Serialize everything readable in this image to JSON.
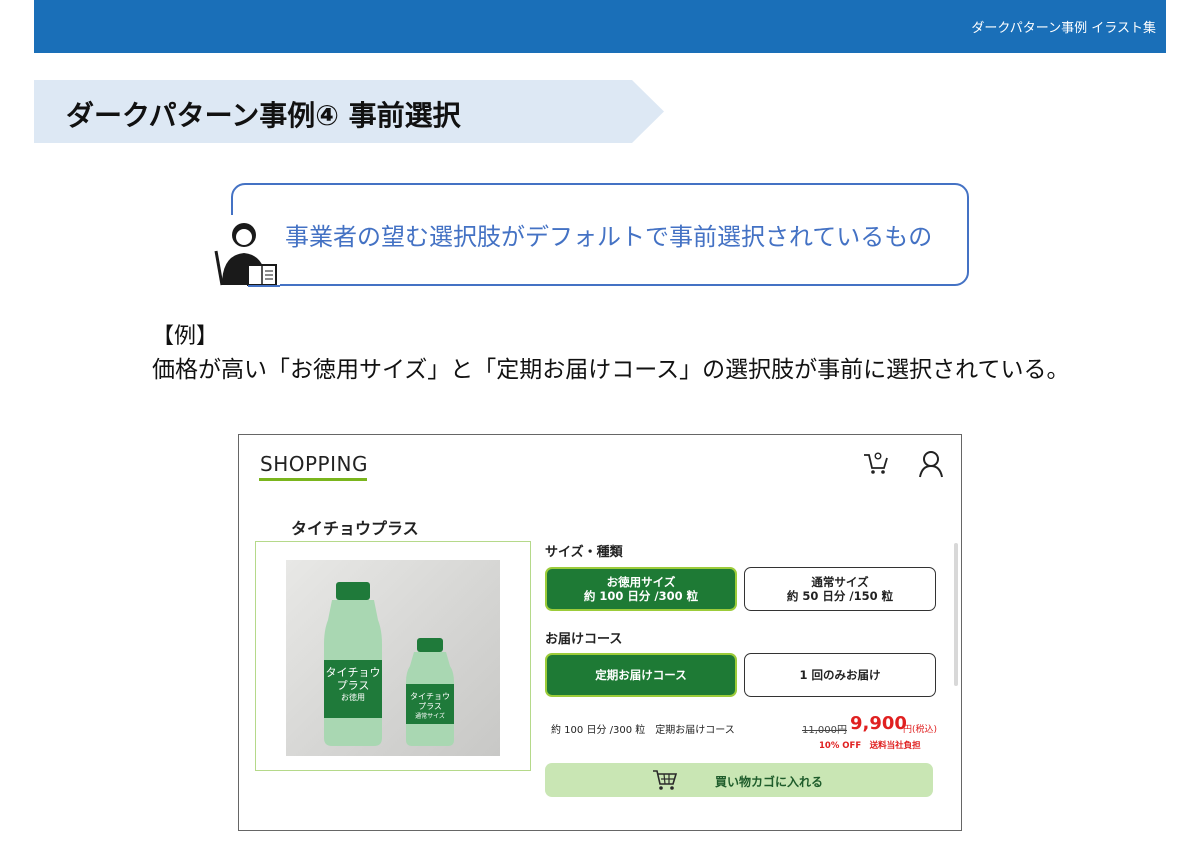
{
  "header": {
    "title": "ダークパターン事例 イラスト集",
    "color": "#1a6fb8"
  },
  "section": {
    "title": "ダークパターン事例④ 事前選択"
  },
  "definition": {
    "text": "事業者の望む選択肢がデフォルトで事前選択されているもの",
    "icon": "teacher-icon"
  },
  "example": {
    "label": "【例】",
    "text": "価格が高い「お徳用サイズ」と「定期お届けコース」の選択肢が事前に選択されている。"
  },
  "shop": {
    "logo": "SHOPPING",
    "accent": "#7ab51d",
    "product_name": "タイチョウプラス",
    "bottle_large": [
      "タイチョウ",
      "プラス",
      "お徳用"
    ],
    "bottle_small": [
      "タイチョウ",
      "プラス",
      "通常サイズ"
    ],
    "size_label": "サイズ・種類",
    "size_options": [
      {
        "line1": "お徳用サイズ",
        "line2": "約 100 日分 /300 粒",
        "selected": true
      },
      {
        "line1": "通常サイズ",
        "line2": "約 50 日分 /150 粒",
        "selected": false
      }
    ],
    "course_label": "お届けコース",
    "course_options": [
      {
        "label": "定期お届けコース",
        "selected": true
      },
      {
        "label": "1 回のみお届け",
        "selected": false
      }
    ],
    "summary": "約 100 日分 /300 粒　定期お届けコース",
    "old_price": "11,000円",
    "new_price": "9,900",
    "price_suffix": "円(税込)",
    "discount": "10% OFF　送料当社負担",
    "cart_button": "買い物カゴに入れる",
    "selected_color": "#1e7a35"
  }
}
